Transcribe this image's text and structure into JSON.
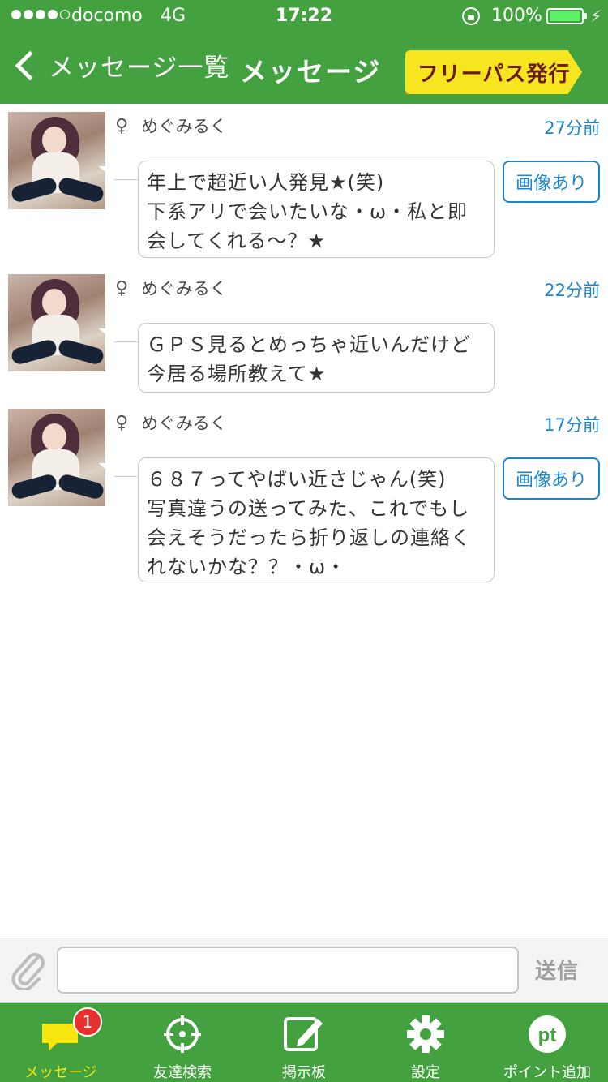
{
  "status_bar": {
    "carrier": "docomo",
    "network": "4G",
    "time": "17:22",
    "battery": "100%",
    "signal_bars_filled": 4,
    "signal_bars_total": 5
  },
  "nav": {
    "back_label": "メッセージ一覧",
    "title": "メッセージ",
    "freepass_label": "フリーパス発行"
  },
  "messages": [
    {
      "sender": "めぐみるく",
      "gender_icon": "♀",
      "time_ago": "27分前",
      "lines": [
        "年上で超近い人発見★(笑)",
        "下系アリで会いたいな・ω・私と即",
        "会してくれる〜？★"
      ],
      "has_image": true,
      "image_button": "画像あり"
    },
    {
      "sender": "めぐみるく",
      "gender_icon": "♀",
      "time_ago": "22分前",
      "lines": [
        "ＧＰＳ見るとめっちゃ近いんだけど",
        "今居る場所教えて★"
      ],
      "has_image": false,
      "image_button": ""
    },
    {
      "sender": "めぐみるく",
      "gender_icon": "♀",
      "time_ago": "17分前",
      "lines": [
        "６８７ってやばい近さじゃん(笑)",
        "写真違うの送ってみた、これでもし",
        "会えそうだったら折り返しの連絡く",
        "れないかな？？・ω・"
      ],
      "has_image": true,
      "image_button": "画像あり"
    }
  ],
  "composer": {
    "send_label": "送信",
    "input_value": ""
  },
  "tabs": [
    {
      "label": "メッセージ",
      "icon": "speech-bubble-icon",
      "badge": "1",
      "active": true
    },
    {
      "label": "友達検索",
      "icon": "crosshair-icon",
      "badge": "",
      "active": false
    },
    {
      "label": "掲示板",
      "icon": "edit-icon",
      "badge": "",
      "active": false
    },
    {
      "label": "設定",
      "icon": "gear-icon",
      "badge": "",
      "active": false
    },
    {
      "label": "ポイント追加",
      "icon": "pt-icon",
      "badge": "",
      "active": false
    }
  ],
  "colors": {
    "brand_green": "#43a23f",
    "link_blue": "#1a86d0",
    "freepass_yellow": "#f7e520",
    "active_tab": "#f5e60f",
    "badge_red": "#e8302e"
  }
}
